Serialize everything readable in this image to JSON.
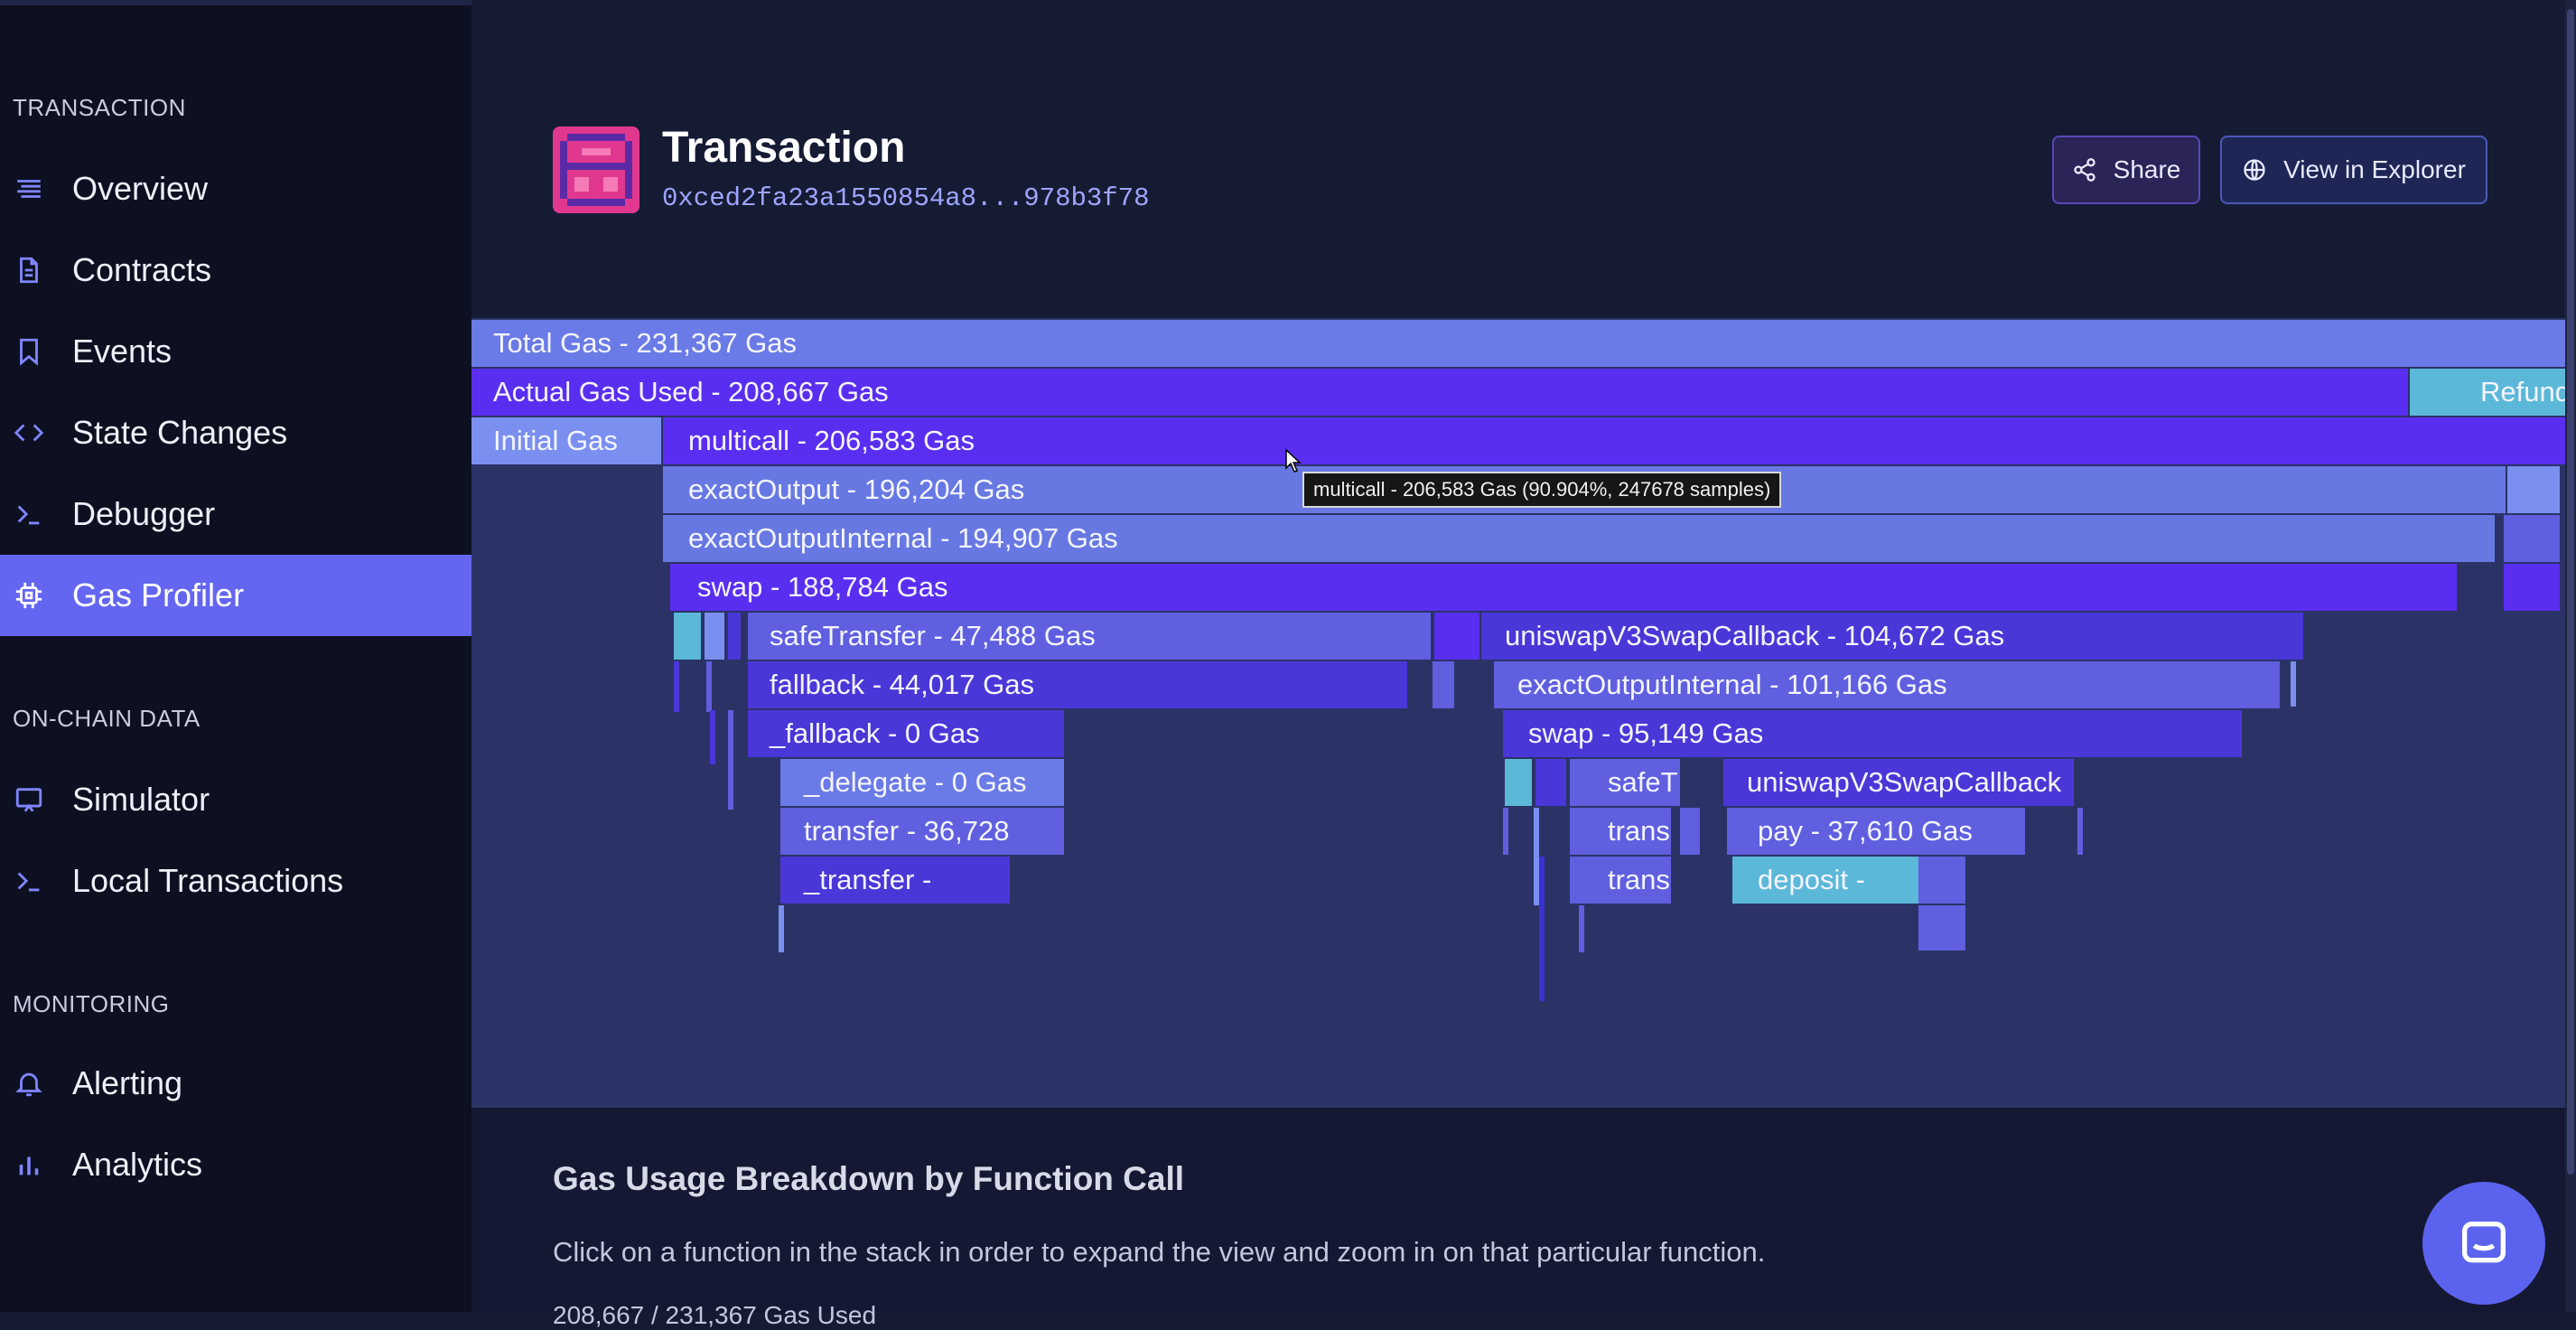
{
  "sidebar": {
    "sections": [
      {
        "title": "TRANSACTION",
        "items": [
          "Overview",
          "Contracts",
          "Events",
          "State Changes",
          "Debugger",
          "Gas Profiler"
        ]
      },
      {
        "title": "ON-CHAIN DATA",
        "items": [
          "Simulator",
          "Local Transactions"
        ]
      },
      {
        "title": "MONITORING",
        "items": [
          "Alerting",
          "Analytics"
        ]
      }
    ],
    "active_item": "Gas Profiler",
    "icons": {
      "Overview": "list-icon",
      "Contracts": "document-icon",
      "Events": "bookmark-icon",
      "State Changes": "code-brackets-icon",
      "Debugger": "terminal-icon",
      "Gas Profiler": "chip-icon",
      "Simulator": "monitor-icon",
      "Local Transactions": "terminal-icon",
      "Alerting": "bell-icon",
      "Analytics": "bar-chart-icon"
    }
  },
  "header": {
    "title": "Transaction",
    "hash": "0xced2fa23a1550854a8...978b3f78",
    "share_label": "Share",
    "explorer_label": "View in Explorer"
  },
  "flame": {
    "total": "Total Gas - 231,367 Gas",
    "actual": "Actual Gas Used - 208,667 Gas",
    "refunded": "Refunded",
    "initial": "Initial Gas",
    "multicall": "multicall - 206,583 Gas",
    "exactOutput": "exactOutput - 196,204 Gas",
    "exactOutputInternal": "exactOutputInternal - 194,907 Gas",
    "swap": "swap - 188,784 Gas",
    "safeTransfer": "safeTransfer - 47,488 Gas",
    "fallback": "fallback - 44,017 Gas",
    "fallback_internal": "_fallback - 0 Gas",
    "delegate": "_delegate - 0 Gas",
    "transfer": "transfer - 36,728",
    "transfer_internal": "_transfer -",
    "callback": "uniswapV3SwapCallback - 104,672 Gas",
    "exactOutputInternal2": "exactOutputInternal - 101,166 Gas",
    "swap2": "swap - 95,149 Gas",
    "safeT": "safeT",
    "trans1": "trans",
    "trans2": "trans",
    "callback2": "uniswapV3SwapCallback",
    "pay": "pay - 37,610 Gas",
    "deposit": "deposit -",
    "tooltip": "multicall - 206,583 Gas (90.904%, 247678 samples)"
  },
  "lower": {
    "title": "Gas Usage Breakdown by Function Call",
    "description": "Click on a function in the stack in order to expand the view and zoom in on that particular function.",
    "partial": "208,667 / 231,367 Gas Used"
  },
  "colors": {
    "accent": "#6466f1",
    "sidebar_bg": "#0d1020",
    "flame_bg": "#2b3366",
    "brand_pink": "#e0388f"
  }
}
